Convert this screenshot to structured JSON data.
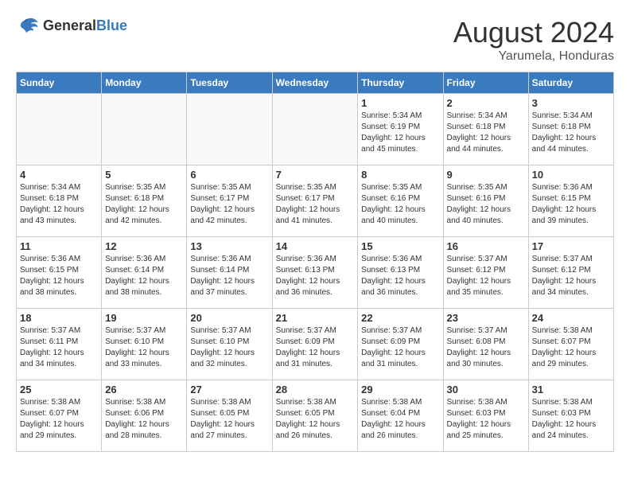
{
  "header": {
    "logo_general": "General",
    "logo_blue": "Blue",
    "month_year": "August 2024",
    "location": "Yarumela, Honduras"
  },
  "weekdays": [
    "Sunday",
    "Monday",
    "Tuesday",
    "Wednesday",
    "Thursday",
    "Friday",
    "Saturday"
  ],
  "weeks": [
    [
      {
        "day": "",
        "info": ""
      },
      {
        "day": "",
        "info": ""
      },
      {
        "day": "",
        "info": ""
      },
      {
        "day": "",
        "info": ""
      },
      {
        "day": "1",
        "info": "Sunrise: 5:34 AM\nSunset: 6:19 PM\nDaylight: 12 hours\nand 45 minutes."
      },
      {
        "day": "2",
        "info": "Sunrise: 5:34 AM\nSunset: 6:18 PM\nDaylight: 12 hours\nand 44 minutes."
      },
      {
        "day": "3",
        "info": "Sunrise: 5:34 AM\nSunset: 6:18 PM\nDaylight: 12 hours\nand 44 minutes."
      }
    ],
    [
      {
        "day": "4",
        "info": "Sunrise: 5:34 AM\nSunset: 6:18 PM\nDaylight: 12 hours\nand 43 minutes."
      },
      {
        "day": "5",
        "info": "Sunrise: 5:35 AM\nSunset: 6:18 PM\nDaylight: 12 hours\nand 42 minutes."
      },
      {
        "day": "6",
        "info": "Sunrise: 5:35 AM\nSunset: 6:17 PM\nDaylight: 12 hours\nand 42 minutes."
      },
      {
        "day": "7",
        "info": "Sunrise: 5:35 AM\nSunset: 6:17 PM\nDaylight: 12 hours\nand 41 minutes."
      },
      {
        "day": "8",
        "info": "Sunrise: 5:35 AM\nSunset: 6:16 PM\nDaylight: 12 hours\nand 40 minutes."
      },
      {
        "day": "9",
        "info": "Sunrise: 5:35 AM\nSunset: 6:16 PM\nDaylight: 12 hours\nand 40 minutes."
      },
      {
        "day": "10",
        "info": "Sunrise: 5:36 AM\nSunset: 6:15 PM\nDaylight: 12 hours\nand 39 minutes."
      }
    ],
    [
      {
        "day": "11",
        "info": "Sunrise: 5:36 AM\nSunset: 6:15 PM\nDaylight: 12 hours\nand 38 minutes."
      },
      {
        "day": "12",
        "info": "Sunrise: 5:36 AM\nSunset: 6:14 PM\nDaylight: 12 hours\nand 38 minutes."
      },
      {
        "day": "13",
        "info": "Sunrise: 5:36 AM\nSunset: 6:14 PM\nDaylight: 12 hours\nand 37 minutes."
      },
      {
        "day": "14",
        "info": "Sunrise: 5:36 AM\nSunset: 6:13 PM\nDaylight: 12 hours\nand 36 minutes."
      },
      {
        "day": "15",
        "info": "Sunrise: 5:36 AM\nSunset: 6:13 PM\nDaylight: 12 hours\nand 36 minutes."
      },
      {
        "day": "16",
        "info": "Sunrise: 5:37 AM\nSunset: 6:12 PM\nDaylight: 12 hours\nand 35 minutes."
      },
      {
        "day": "17",
        "info": "Sunrise: 5:37 AM\nSunset: 6:12 PM\nDaylight: 12 hours\nand 34 minutes."
      }
    ],
    [
      {
        "day": "18",
        "info": "Sunrise: 5:37 AM\nSunset: 6:11 PM\nDaylight: 12 hours\nand 34 minutes."
      },
      {
        "day": "19",
        "info": "Sunrise: 5:37 AM\nSunset: 6:10 PM\nDaylight: 12 hours\nand 33 minutes."
      },
      {
        "day": "20",
        "info": "Sunrise: 5:37 AM\nSunset: 6:10 PM\nDaylight: 12 hours\nand 32 minutes."
      },
      {
        "day": "21",
        "info": "Sunrise: 5:37 AM\nSunset: 6:09 PM\nDaylight: 12 hours\nand 31 minutes."
      },
      {
        "day": "22",
        "info": "Sunrise: 5:37 AM\nSunset: 6:09 PM\nDaylight: 12 hours\nand 31 minutes."
      },
      {
        "day": "23",
        "info": "Sunrise: 5:37 AM\nSunset: 6:08 PM\nDaylight: 12 hours\nand 30 minutes."
      },
      {
        "day": "24",
        "info": "Sunrise: 5:38 AM\nSunset: 6:07 PM\nDaylight: 12 hours\nand 29 minutes."
      }
    ],
    [
      {
        "day": "25",
        "info": "Sunrise: 5:38 AM\nSunset: 6:07 PM\nDaylight: 12 hours\nand 29 minutes."
      },
      {
        "day": "26",
        "info": "Sunrise: 5:38 AM\nSunset: 6:06 PM\nDaylight: 12 hours\nand 28 minutes."
      },
      {
        "day": "27",
        "info": "Sunrise: 5:38 AM\nSunset: 6:05 PM\nDaylight: 12 hours\nand 27 minutes."
      },
      {
        "day": "28",
        "info": "Sunrise: 5:38 AM\nSunset: 6:05 PM\nDaylight: 12 hours\nand 26 minutes."
      },
      {
        "day": "29",
        "info": "Sunrise: 5:38 AM\nSunset: 6:04 PM\nDaylight: 12 hours\nand 26 minutes."
      },
      {
        "day": "30",
        "info": "Sunrise: 5:38 AM\nSunset: 6:03 PM\nDaylight: 12 hours\nand 25 minutes."
      },
      {
        "day": "31",
        "info": "Sunrise: 5:38 AM\nSunset: 6:03 PM\nDaylight: 12 hours\nand 24 minutes."
      }
    ]
  ]
}
